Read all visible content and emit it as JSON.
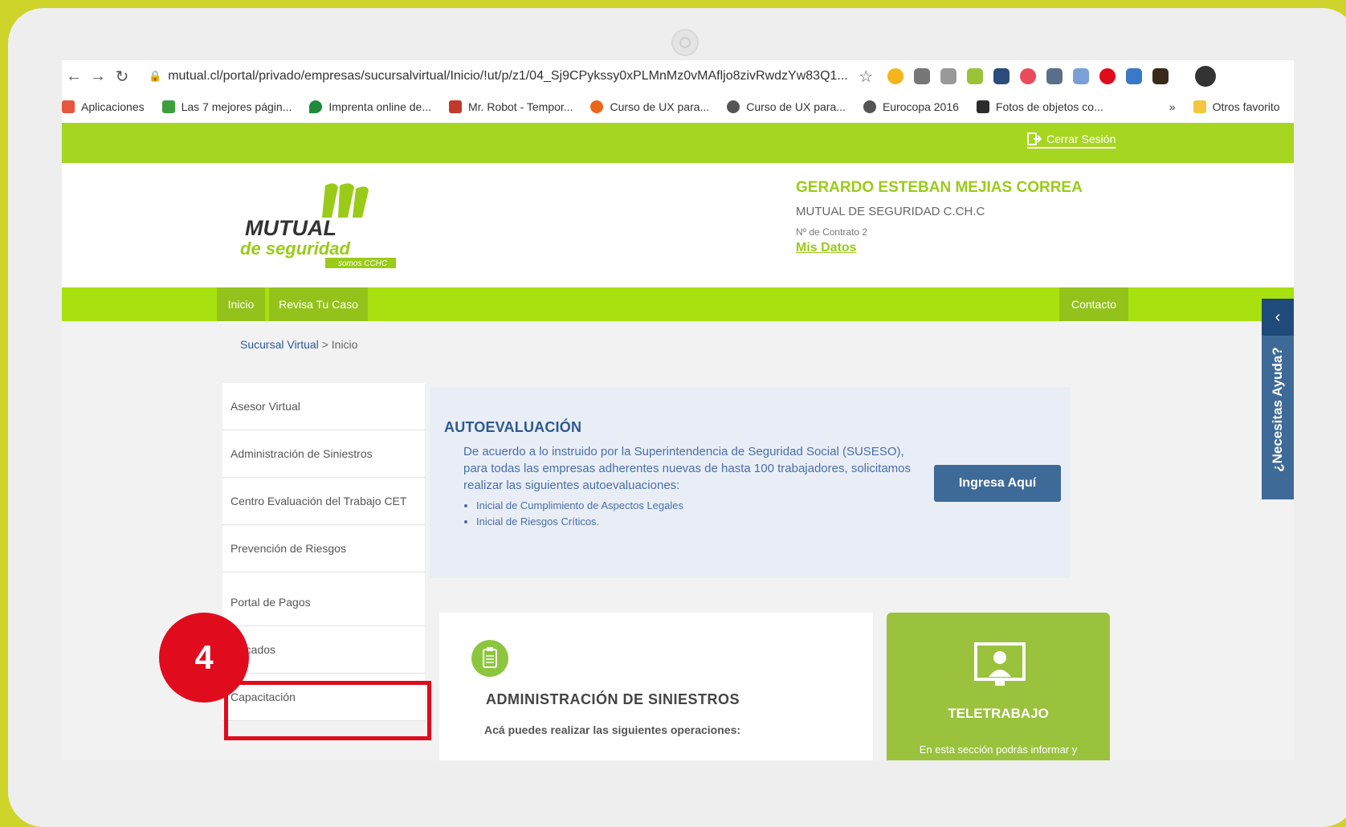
{
  "browser": {
    "url": "mutual.cl/portal/privado/empresas/sucursalvirtual/Inicio/!ut/p/z1/04_Sj9CPykssy0xPLMnMz0vMAfljo8zivRwdzYw83Q1...",
    "bookmarks": [
      {
        "label": "Aplicaciones",
        "icon": "apps-grid-icon",
        "color": "#e8553f"
      },
      {
        "label": "Las 7 mejores págin...",
        "icon": "bookmark-icon",
        "color": "#3ca03c"
      },
      {
        "label": "Imprenta online de...",
        "icon": "drop-icon",
        "color": "#1e8a3c"
      },
      {
        "label": "Mr. Robot - Tempor...",
        "icon": "bookmark-icon",
        "color": "#c0392b"
      },
      {
        "label": "Curso de UX para...",
        "icon": "flame-icon",
        "color": "#e8671a"
      },
      {
        "label": "Curso de UX para...",
        "icon": "globe-icon",
        "color": "#555555"
      },
      {
        "label": "Eurocopa 2016",
        "icon": "globe-icon",
        "color": "#555555"
      },
      {
        "label": "Fotos de objetos co...",
        "icon": "bookmark-icon",
        "color": "#2b2b2b"
      }
    ],
    "more_bookmarks": "»",
    "other_favorites": "Otros favorito"
  },
  "site": {
    "logout_label": "Cerrar Sesión",
    "logo": {
      "line1": "MUTUAL",
      "line2": "de seguridad",
      "tag": "somos CCHC"
    },
    "user": {
      "name": "GERARDO ESTEBAN MEJIAS CORREA",
      "org": "MUTUAL DE SEGURIDAD C.CH.C",
      "contract": "Nº de Contrato 2",
      "my_data_label": "Mis Datos"
    },
    "menu": {
      "inicio": "Inicio",
      "revisa": "Revisa Tu Caso",
      "contacto": "Contacto"
    },
    "breadcrumb": {
      "root": "Sucursal Virtual",
      "sep": ">",
      "current": "Inicio"
    },
    "sidebar": [
      "Asesor Virtual",
      "Administración de Siniestros",
      "Centro Evaluación del Trabajo CET",
      "Prevención de Riesgos",
      "Portal de Pagos",
      "rtificados",
      "Capacitación"
    ],
    "autoevaluacion": {
      "title": "AUTOEVALUACIÓN",
      "text": "De acuerdo a lo instruido por la Superintendencia de Seguridad Social (SUSESO), para todas las empresas adherentes nuevas de hasta 100 trabajadores, solicitamos realizar las siguientes autoevaluaciones:",
      "items": [
        "Inicial de Cumplimiento de Aspectos Legales",
        "Inicial de Riesgos Críticos."
      ],
      "button_label": "Ingresa Aquí"
    },
    "siniestros": {
      "title": "ADMINISTRACIÓN DE SINIESTROS",
      "text": "Acá puedes realizar las siguientes operaciones:"
    },
    "teletrabajo": {
      "title": "TELETRABAJO",
      "text": "En esta sección podrás informar y"
    },
    "help": {
      "label": "¿Necesitas Ayuda?",
      "arrow": "‹"
    }
  },
  "annotation": {
    "step": "4"
  },
  "colors": {
    "brand_green": "#a6d61f",
    "accent_blue": "#3e6a98",
    "highlight_red": "#e00b1c",
    "frame_yellow": "#cfd42a"
  }
}
